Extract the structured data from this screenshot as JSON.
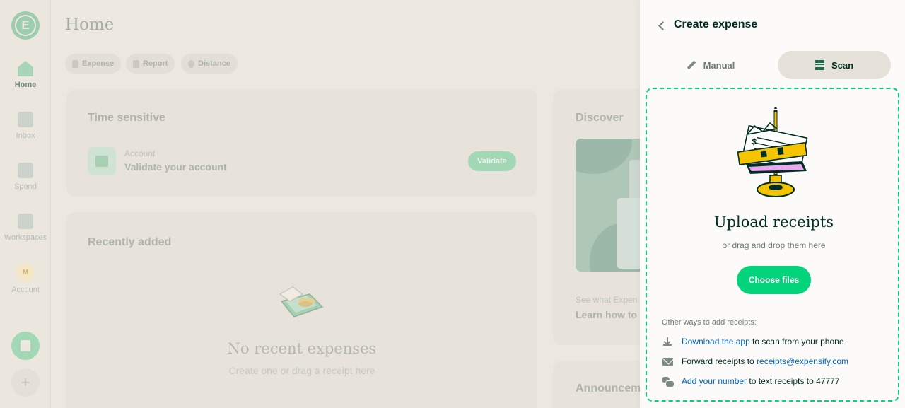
{
  "nav": {
    "logo_letter": "E",
    "items": [
      {
        "label": "Home",
        "icon": "home-icon",
        "active": true
      },
      {
        "label": "Inbox",
        "icon": "inbox-icon"
      },
      {
        "label": "Spend",
        "icon": "receipt-icon"
      },
      {
        "label": "Workspaces",
        "icon": "building-icon"
      },
      {
        "label": "Account",
        "icon": "avatar",
        "avatar_letter": "M"
      }
    ],
    "fab_create": "create-expense-icon",
    "fab_add": "+"
  },
  "main": {
    "page_title": "Home",
    "quick_actions": [
      "Expense",
      "Report",
      "Distance"
    ],
    "time_sensitive": {
      "title": "Time sensitive",
      "item_category": "Account",
      "item_title": "Validate your account",
      "action_label": "Validate"
    },
    "recently_added": {
      "title": "Recently added",
      "empty_title": "No recent expenses",
      "empty_subtitle": "Create one or drag a receipt here"
    },
    "discover": {
      "title": "Discover",
      "teaser": "See what Expen",
      "link": "Learn how to"
    },
    "announcements": {
      "title": "Announcem"
    }
  },
  "panel": {
    "title": "Create expense",
    "tabs": [
      {
        "label": "Manual",
        "icon": "pencil-icon",
        "selected": false
      },
      {
        "label": "Scan",
        "icon": "scan-icon",
        "selected": true
      }
    ],
    "upload_title": "Upload receipts",
    "upload_subtitle": "or drag and drop them here",
    "choose_files": "Choose files",
    "other_ways_title": "Other ways to add receipts:",
    "ways": {
      "download_link": "Download the app",
      "download_rest": "to scan from your phone",
      "forward_text": "Forward receipts to",
      "forward_email": "receipts@expensify.com",
      "number_link": "Add your number",
      "number_rest": "to text receipts to 47777"
    }
  },
  "colors": {
    "accent_green": "#03d47c",
    "link_blue": "#0164bf",
    "text_dark": "#002e22",
    "text_muted": "#6d7a72"
  }
}
